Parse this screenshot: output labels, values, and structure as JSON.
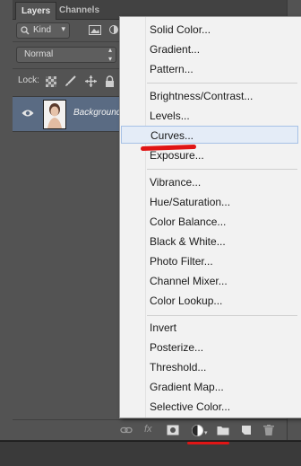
{
  "tabs": [
    "Layers",
    "Channels"
  ],
  "filter": {
    "kind": "Kind",
    "search_icon": "search-icon"
  },
  "blend_mode": "Normal",
  "lock": {
    "label": "Lock:"
  },
  "layer": {
    "name": "Background"
  },
  "menu": {
    "groups": [
      [
        "Solid Color...",
        "Gradient...",
        "Pattern..."
      ],
      [
        "Brightness/Contrast...",
        "Levels...",
        "Curves...",
        "Exposure..."
      ],
      [
        "Vibrance...",
        "Hue/Saturation...",
        "Color Balance...",
        "Black & White...",
        "Photo Filter...",
        "Channel Mixer...",
        "Color Lookup..."
      ],
      [
        "Invert",
        "Posterize...",
        "Threshold...",
        "Gradient Map...",
        "Selective Color..."
      ]
    ],
    "highlighted": "Curves..."
  },
  "colors": {
    "menu_bg": "#f2f2f2",
    "highlight": "#e4ecf7",
    "annotation": "#e01515"
  }
}
